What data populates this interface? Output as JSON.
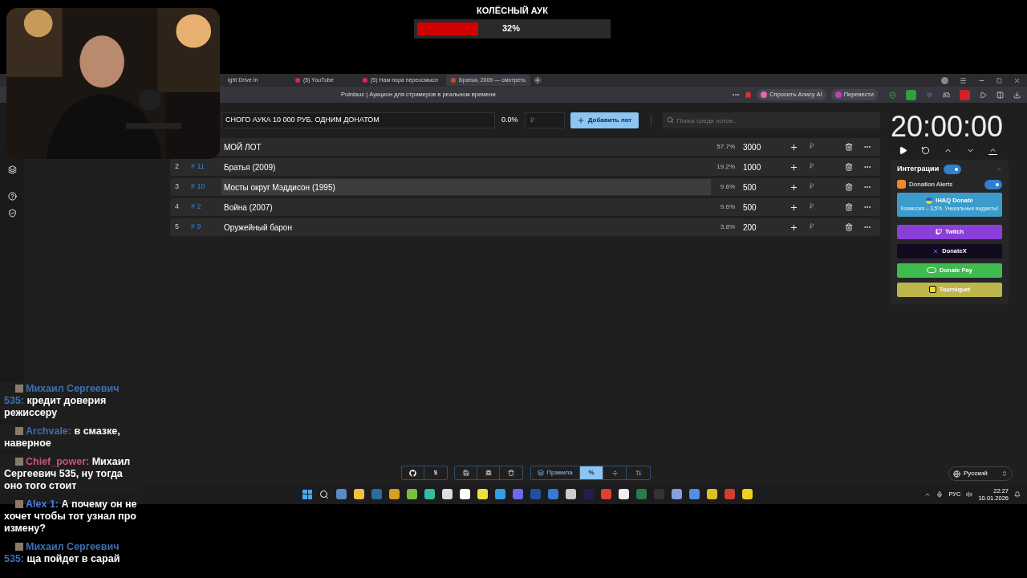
{
  "overlay": {
    "title": "КОЛЁСНЫЙ АУК",
    "progress": {
      "level": 0.32,
      "reading": "32%"
    }
  },
  "browser": {
    "tabs": [
      {
        "label": "ight Drive In",
        "selected": false
      },
      {
        "label": "(5) YouTube",
        "selected": false
      },
      {
        "label": "(5) Нам пора переосмысл",
        "selected": false
      },
      {
        "label": "Братья, 2009 — смотреть",
        "selected": true
      }
    ],
    "page_title": "Pointauc | Аукцион для стримеров в реальном времени",
    "toolbar_buttons": [
      "Спросить Алису AI",
      "Перевести"
    ]
  },
  "auction": {
    "new_lot": {
      "value": "СНОГО АУКА 10 000 РУБ. ОДНИМ ДОНАТОМ",
      "percent": "0.0%",
      "amount_placeholder": "₽",
      "add_button": "Добавить лот"
    },
    "search": {
      "placeholder": "Поиск среди лотов..."
    },
    "lots": [
      {
        "name": "МОЙ ЛОТ",
        "percent": "57.7%",
        "amount": "3000",
        "currency": "₽",
        "selected": false
      },
      {
        "number": "2",
        "id": "# 11",
        "name": "Братья (2009)",
        "percent": "19.2%",
        "amount": "1000",
        "currency": "₽",
        "selected": false
      },
      {
        "number": "3",
        "id": "# 10",
        "name": "Мосты округ Мэддисон (1995)",
        "percent": "9.6%",
        "amount": "500",
        "currency": "₽",
        "selected": true
      },
      {
        "number": "4",
        "id": "# 2",
        "name": "Война (2007)",
        "percent": "9.6%",
        "amount": "500",
        "currency": "₽",
        "selected": false
      },
      {
        "number": "5",
        "id": "# 9",
        "name": "Оружейный барон",
        "percent": "3.8%",
        "amount": "200",
        "currency": "₽",
        "selected": false
      }
    ]
  },
  "timer": {
    "time": "20:00:00"
  },
  "integrations": {
    "title": "Интеграции",
    "on": true,
    "donation_alerts": {
      "label": "Donation Alerts",
      "on": true
    },
    "services": [
      {
        "kind": "ihaq",
        "label": "IHAQ Donate",
        "subtitle": "Комиссия – 3,5%. Уникальные виджеты!",
        "color": "#3b9ccc"
      },
      {
        "kind": "twitch",
        "label": "Twitch",
        "color": "#8b3fd9"
      },
      {
        "kind": "donatex",
        "label": "DonateX",
        "color": "#120a1e"
      },
      {
        "kind": "donatepay",
        "label": "Donate Pay",
        "color": "#3fba4f"
      },
      {
        "kind": "tourniquet",
        "label": "Tourniquet",
        "color": "#bdb64a"
      }
    ]
  },
  "bottom_toolbar": {
    "dollar": "$",
    "modes": [
      {
        "label": "Правила",
        "selected": false
      },
      {
        "label": "%",
        "selected": true
      },
      {
        "selected": false
      },
      {
        "selected": false
      }
    ],
    "language": "Русский"
  },
  "taskbar": {
    "language": "РУС",
    "time": "22:27",
    "date": "10.01.2026"
  },
  "chat": [
    {
      "name": "Михаил Сергеевич 535:",
      "text": "кредит доверия режиссеру",
      "color": "#3d6fb5"
    },
    {
      "name": "Archvale:",
      "text": "в смазке, наверное",
      "color": "#3d6fb5"
    },
    {
      "name": "Chief_power:",
      "text": "Михаил Сергеевич 535, ну тогда оно того стоит",
      "color": "#d0507a"
    },
    {
      "name": "Alex 1:",
      "text": "А почему он не хочет чтобы тот узнал про измену?",
      "color": "#4a80d4"
    },
    {
      "name": "Михаил Сергеевич 535:",
      "text": "ща пойдет в сарай",
      "color": "#3d6fb5"
    }
  ]
}
